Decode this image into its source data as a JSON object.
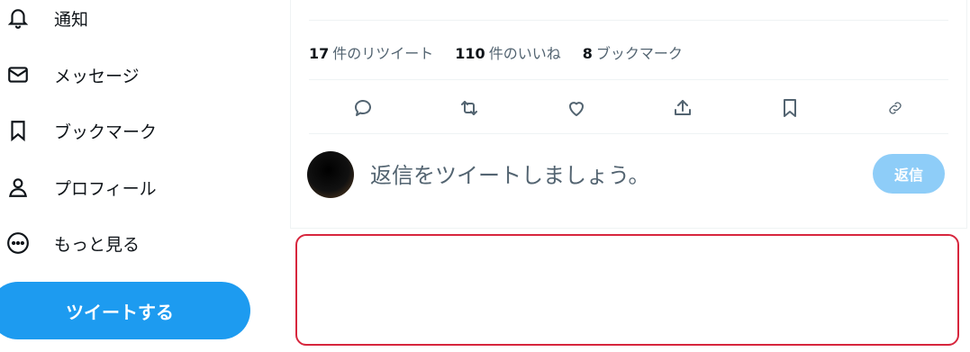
{
  "sidebar": {
    "items": [
      {
        "icon": "bell-icon",
        "label": "通知"
      },
      {
        "icon": "envelope-icon",
        "label": "メッセージ"
      },
      {
        "icon": "bookmark-icon",
        "label": "ブックマーク"
      },
      {
        "icon": "person-icon",
        "label": "プロフィール"
      },
      {
        "icon": "more-circle-icon",
        "label": "もっと見る"
      }
    ],
    "tweet_button": "ツイートする"
  },
  "tweet": {
    "stats": [
      {
        "count": "17",
        "label": "件のリツイート"
      },
      {
        "count": "110",
        "label": "件のいいね"
      },
      {
        "count": "8",
        "label": "ブックマーク"
      }
    ],
    "actions": [
      "reply-icon",
      "retweet-icon",
      "like-icon",
      "share-icon",
      "bookmark-icon",
      "link-icon"
    ]
  },
  "reply": {
    "placeholder": "返信をツイートしましょう。",
    "button": "返信"
  },
  "colors": {
    "accent": "#1d9bf0",
    "reply_button_disabled": "#8ecdf8",
    "highlight_border": "#d7263d"
  }
}
